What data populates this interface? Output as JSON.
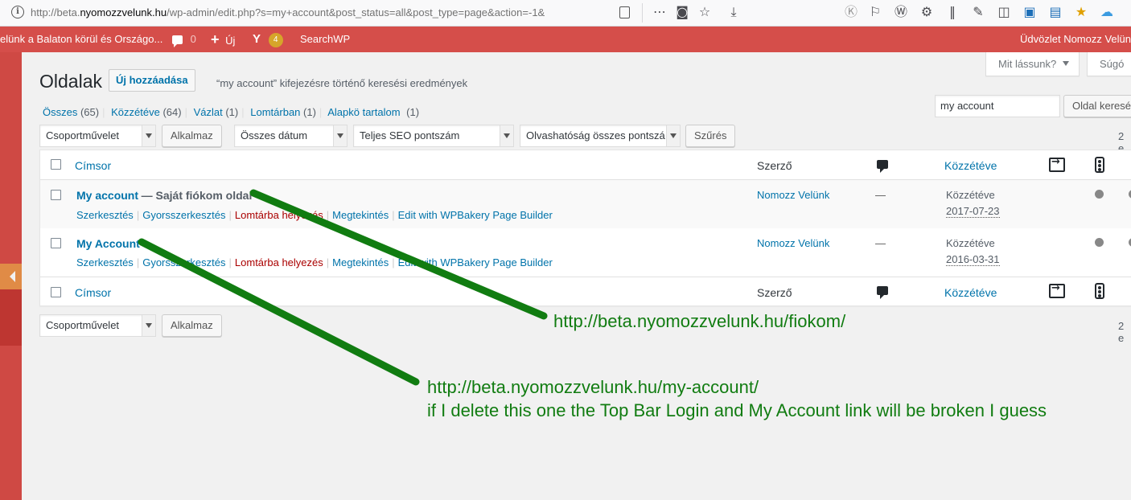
{
  "browser": {
    "url_prefix": "http://beta.",
    "url_host": "nyomozzvelunk.hu",
    "url_rest": "/wp-admin/edit.php?s=my+account&post_status=all&post_type=page&action=-1&",
    "icons": [
      "info-icon",
      "reader-icon",
      "more-icon",
      "pocket-icon",
      "star-icon",
      "download-icon",
      "k-icon",
      "bookmark-icon",
      "wp-icon",
      "gear-icon",
      "library-icon",
      "wrench-icon",
      "sidebar-icon",
      "s-icon",
      "save-icon",
      "favorite-icon",
      "cloud-icon"
    ]
  },
  "adminbar": {
    "site_name": "elünk a Balaton körül és Országo...",
    "comments_count": "0",
    "new_label": "Új",
    "yoast_badge": "4",
    "searchwp_label": "SearchWP",
    "greeting": "Üdvözlet Nomozz Velün"
  },
  "screen_meta": {
    "options_label": "Mit lássunk?",
    "help_label": "Súgó"
  },
  "header": {
    "title": "Oldalak",
    "add_new": "Új hozzáadása",
    "search_subtitle": "“my account” kifejezésre történő keresési eredmények"
  },
  "views": [
    {
      "label": "Összes",
      "count": "(65)"
    },
    {
      "label": "Közzétéve",
      "count": "(64)"
    },
    {
      "label": "Vázlat",
      "count": "(1)"
    },
    {
      "label": "Lomtárban",
      "count": "(1)"
    },
    {
      "label": "Alapkö tartalom",
      "count": "(1)"
    }
  ],
  "search": {
    "value": "my account",
    "button": "Oldal keresés"
  },
  "filters": {
    "bulk_action": "Csoportművelet",
    "apply": "Alkalmaz",
    "dates": "Összes dátum",
    "seo": "Teljes SEO pontszám",
    "readability": "Olvashatóság összes pontszám",
    "filter_button": "Szűrés",
    "items_count": "2 e"
  },
  "table": {
    "columns": {
      "title": "Címsor",
      "author": "Szerző",
      "date": "Közzétéve"
    },
    "rows": [
      {
        "title": "My account",
        "state": "— Saját fiókom oldal",
        "author": "Nomozz Velünk",
        "comments": "—",
        "status": "Közzétéve",
        "date": "2017-07-23",
        "actions": [
          "Szerkesztés",
          "Gyorsszerkesztés",
          "Lomtárba helyezés",
          "Megtekintés",
          "Edit with WPBakery Page Builder"
        ]
      },
      {
        "title": "My Account",
        "state": "",
        "author": "Nomozz Velünk",
        "comments": "—",
        "status": "Közzétéve",
        "date": "2016-03-31",
        "actions": [
          "Szerkesztés",
          "Gyorsszerkesztés",
          "Lomtárba helyezés",
          "Megtekintés",
          "Edit with WPBakery Page Builder"
        ]
      }
    ]
  },
  "annotations": {
    "line1": "http://beta.nyomozzvelunk.hu/fiokom/",
    "line2": "http://beta.nyomozzvelunk.hu/my-account/",
    "line3": "if I delete this one the Top Bar Login and My Account link will be broken I guess",
    "color": "#117c11"
  },
  "colors": {
    "adminbar": "#d54e4a",
    "sidemenu": "#cf4944",
    "link": "#0073aa",
    "trash": "#aa0000"
  }
}
